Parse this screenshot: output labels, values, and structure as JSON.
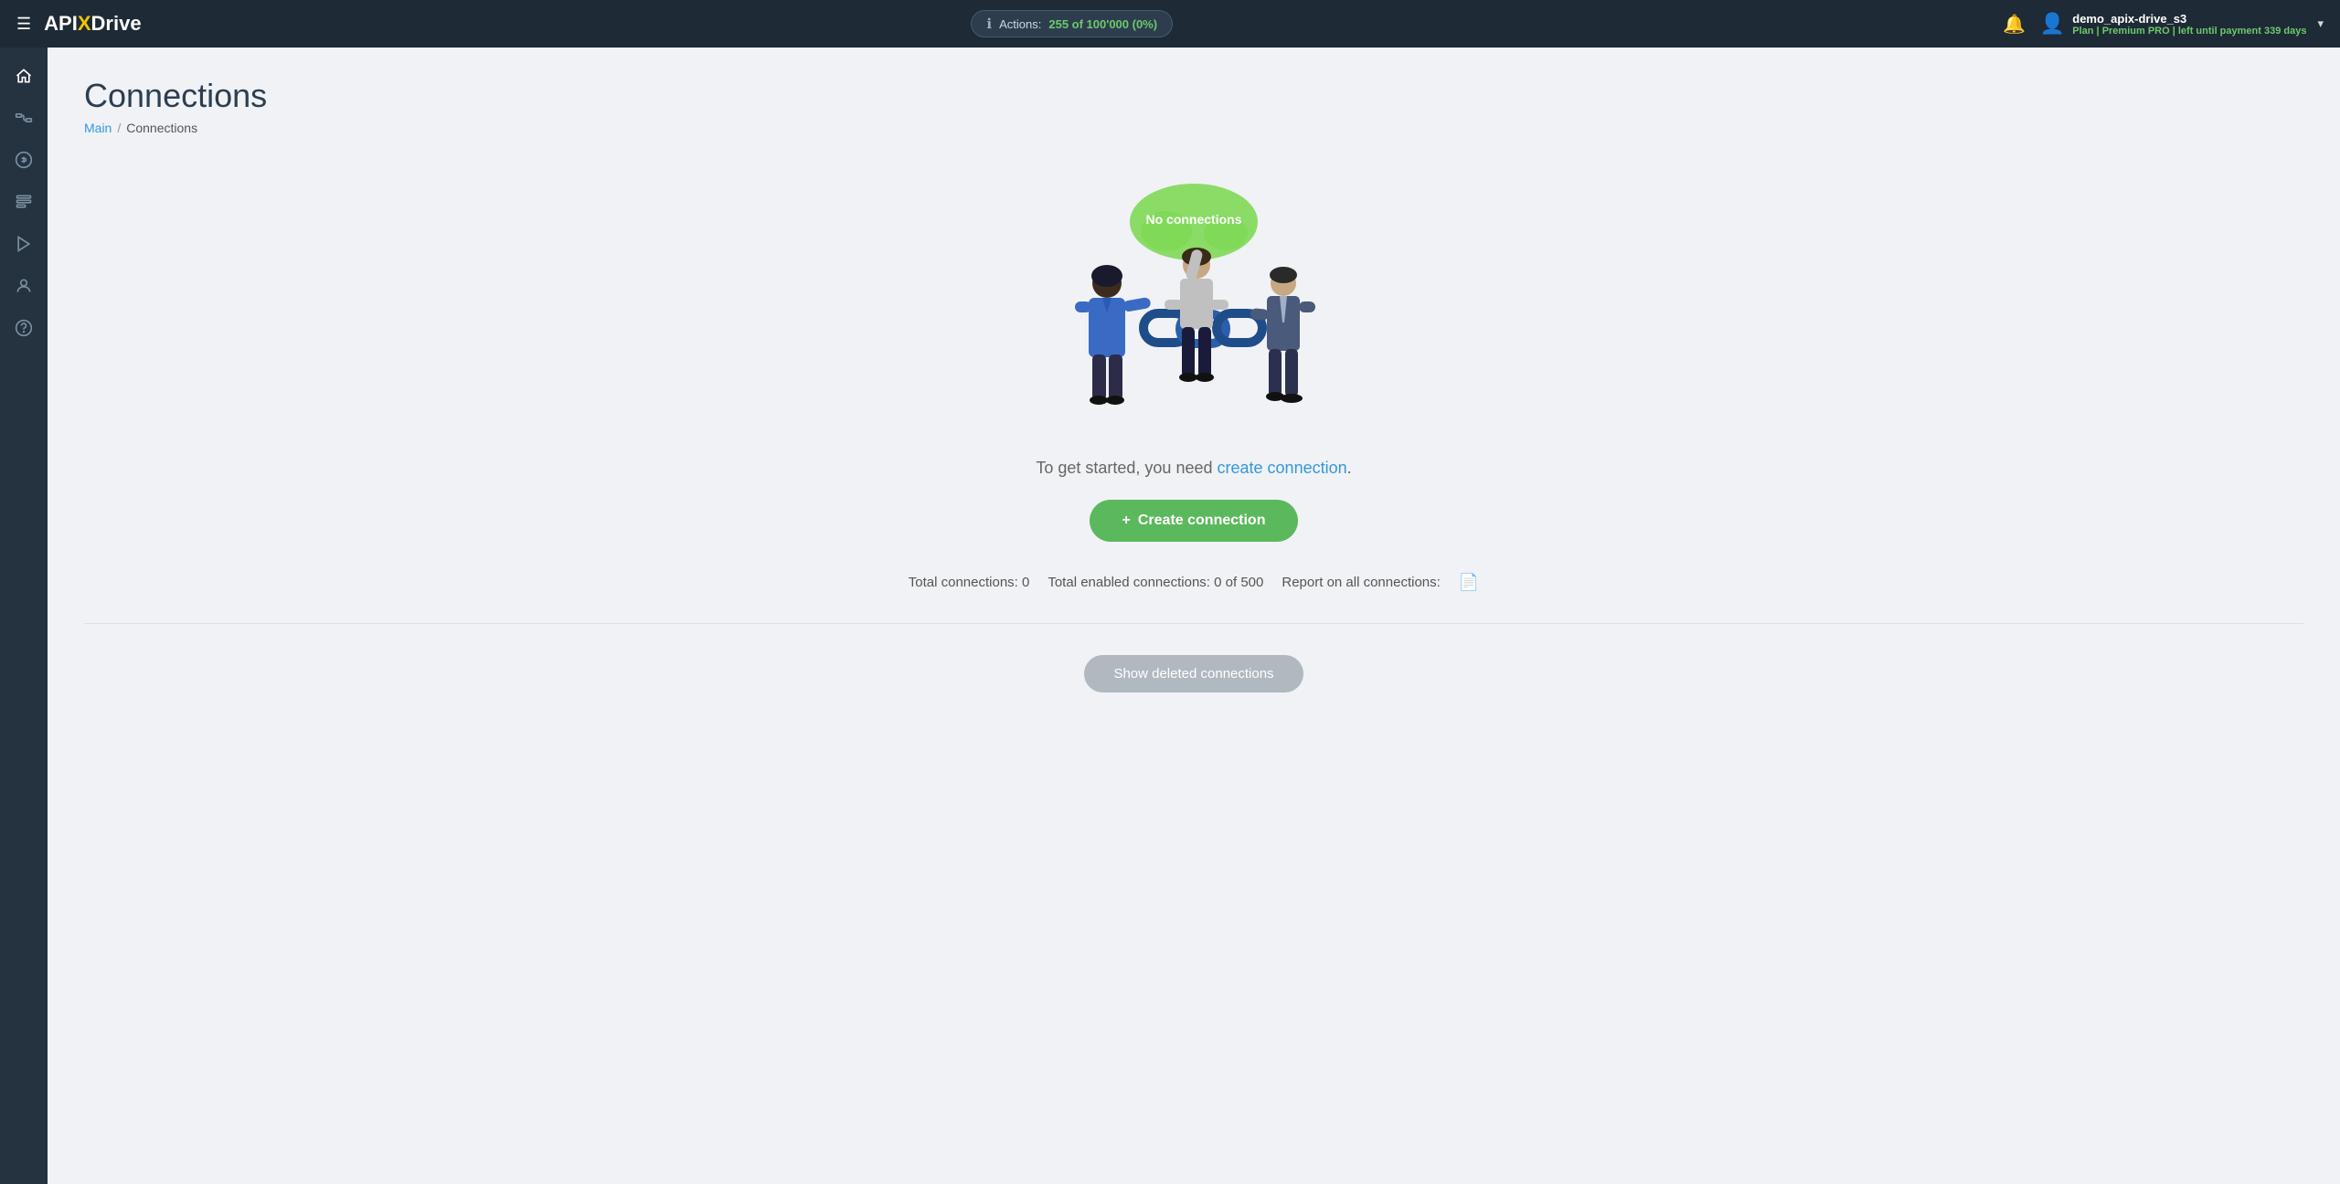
{
  "topnav": {
    "logo": {
      "api": "API",
      "x": "X",
      "drive": "Drive"
    },
    "actions": {
      "label": "Actions:",
      "count": "255 of 100'000 (0%)"
    },
    "user": {
      "name": "demo_apix-drive_s3",
      "plan_label": "Plan |",
      "plan_name": "Premium PRO",
      "plan_suffix": "| left until payment",
      "days": "339 days"
    }
  },
  "sidebar": {
    "items": [
      {
        "icon": "⌂",
        "name": "home"
      },
      {
        "icon": "⛋",
        "name": "connections"
      },
      {
        "icon": "$",
        "name": "billing"
      },
      {
        "icon": "🧰",
        "name": "tools"
      },
      {
        "icon": "▶",
        "name": "video"
      },
      {
        "icon": "👤",
        "name": "profile"
      },
      {
        "icon": "?",
        "name": "help"
      }
    ]
  },
  "page": {
    "title": "Connections",
    "breadcrumb_main": "Main",
    "breadcrumb_sep": "/",
    "breadcrumb_current": "Connections"
  },
  "illustration": {
    "cloud_text": "No connections"
  },
  "cta": {
    "text_before": "To get started, you need",
    "link_text": "create connection",
    "text_after": ".",
    "button_icon": "+",
    "button_label": "Create connection"
  },
  "stats": {
    "total_connections_label": "Total connections:",
    "total_connections_value": "0",
    "total_enabled_label": "Total enabled connections:",
    "total_enabled_value": "0 of 500",
    "report_label": "Report on all connections:"
  },
  "show_deleted": {
    "label": "Show deleted connections"
  }
}
